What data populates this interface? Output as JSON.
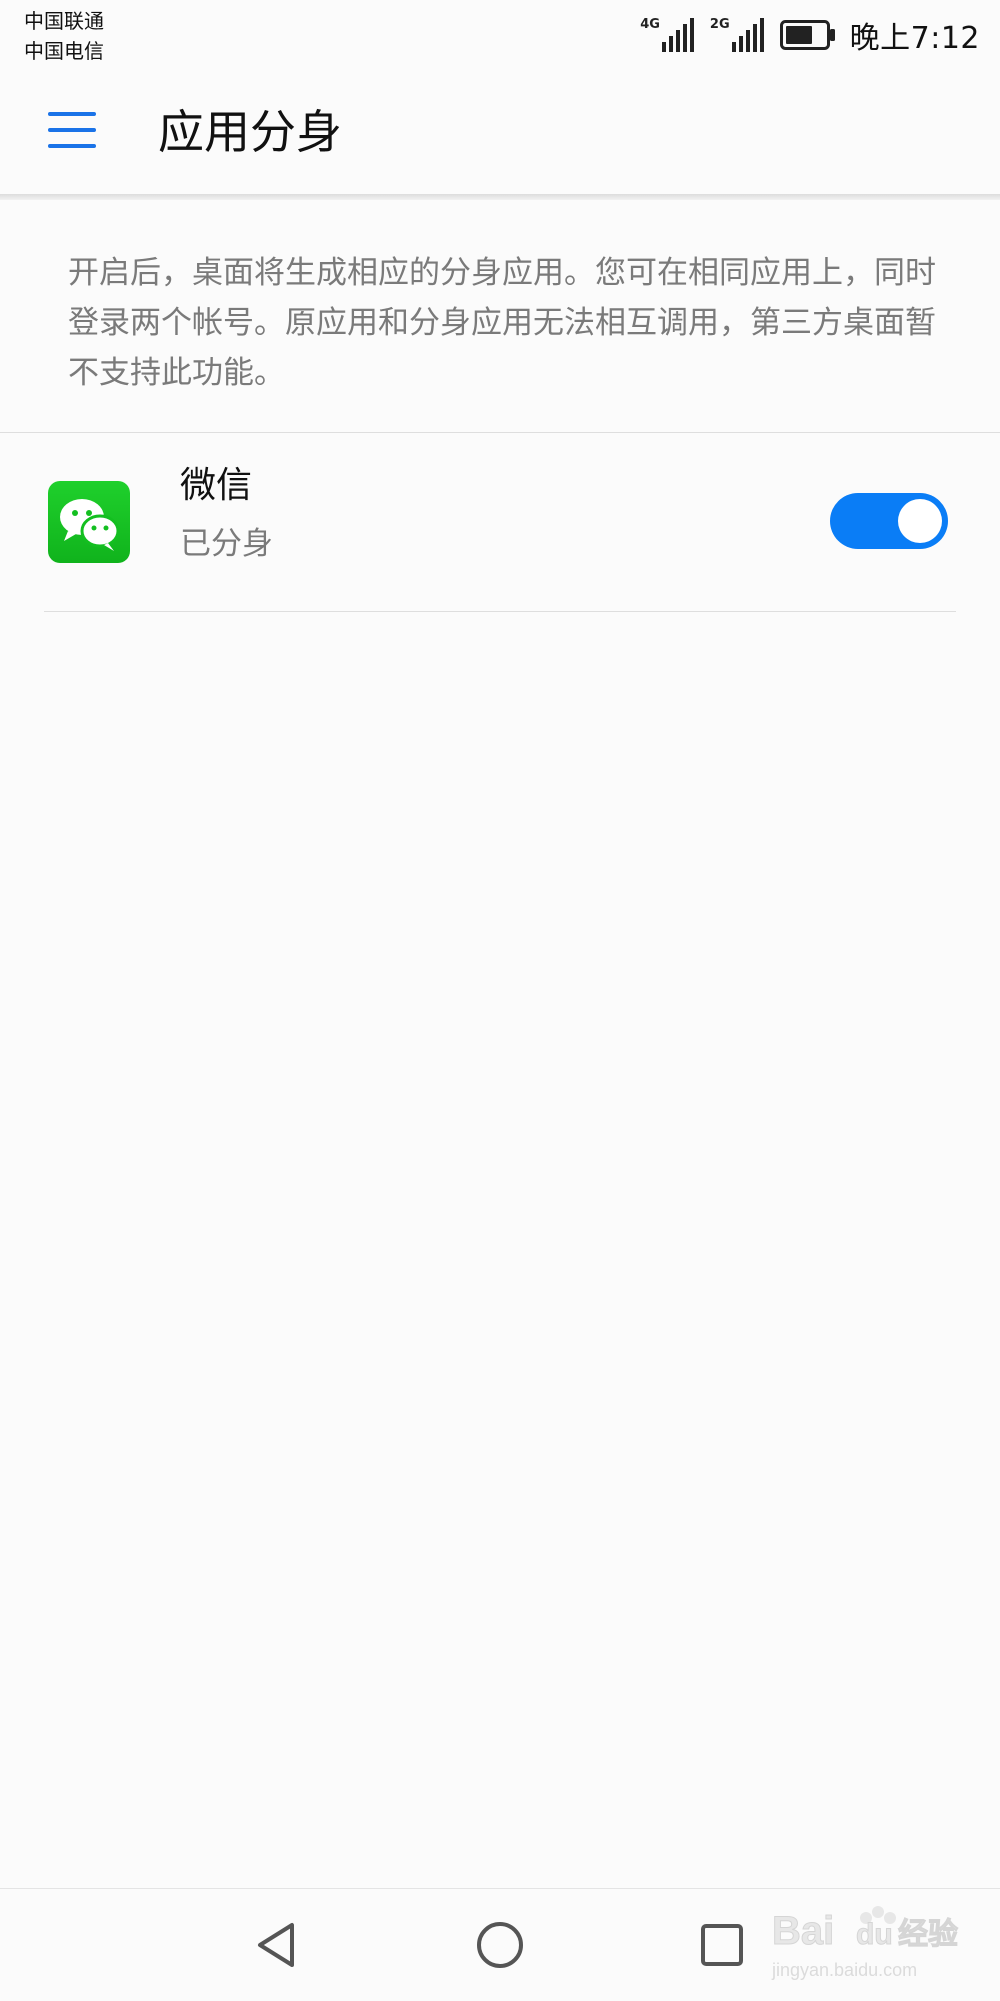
{
  "status_bar": {
    "carrier_1": "中国联通",
    "carrier_2": "中国电信",
    "network_1": "4G",
    "network_2": "2G",
    "time": "晚上7:12",
    "icons": [
      "signal-4g-icon",
      "signal-2g-icon",
      "battery-icon"
    ]
  },
  "app_bar": {
    "title": "应用分身",
    "menu_icon": "hamburger-menu-icon",
    "accent_color": "#1a73e8"
  },
  "description": "开启后，桌面将生成相应的分身应用。您可在相同应用上，同时登录两个帐号。原应用和分身应用无法相互调用，第三方桌面暂不支持此功能。",
  "apps": [
    {
      "name": "微信",
      "status": "已分身",
      "icon": "wechat-icon",
      "enabled": true,
      "toggle_color": "#0a7df6"
    }
  ],
  "nav_bar": {
    "icons": [
      "back-triangle-icon",
      "home-circle-icon",
      "recents-square-icon"
    ]
  },
  "watermark": {
    "logo_text": "Bai du 经验",
    "url_text": "jingyan.baidu.com"
  }
}
